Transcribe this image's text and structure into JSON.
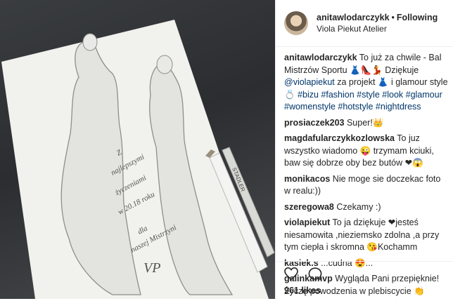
{
  "post": {
    "username": "anitawlodarczykk",
    "separator": "•",
    "follow_label": "Following",
    "location": "Viola Piekut Atelier",
    "likes": "961 likes"
  },
  "caption": {
    "user": "anitawlodarczykk",
    "text1": "To już za chwile - Bal Mistrzów Sportu 👗👠💃 Dziękuje ",
    "mention": "@violapiekut",
    "text2": " za projekt 👗 i glamour style💍 ",
    "hashtags": "#bizu #fashion #style #look #glamour #womenstyle #hotstyle #nightdress"
  },
  "comments": [
    {
      "user": "prosiaczek203",
      "text": "Super!👑"
    },
    {
      "user": "magdafularczykkozlowska",
      "text": "To juz wszystko wiadomo 😜 trzymam kciuki, baw się dobrze oby bez butów ❤😱"
    },
    {
      "user": "monikacos",
      "text": "Nie moge sie doczekac foto w realu:))"
    },
    {
      "user": "szeregowa8",
      "text": "Czekamy :)"
    },
    {
      "user": "violapiekut",
      "text": "To ja dziękuje ❤jesteś niesamowita ,nieziemsko zdolna ,a przy tym ciepła i skromna 😘Kochamm"
    },
    {
      "user": "kasiek.s",
      "text": "...cudna 😍..."
    },
    {
      "user": "galinkamvp",
      "text": "Wygląda Pani przepięknie! Życzę powodzenia w plebiscycie 👏"
    }
  ],
  "sketch_text": [
    "Z",
    "najlepszymi",
    "życzeniami",
    "w 20.18 roku",
    "dla",
    "naszej Mistrzyni"
  ],
  "sketch_sign": "VP",
  "pencil_brand": "STADLER",
  "icons": {
    "like": "heart-icon",
    "comment": "comment-icon"
  },
  "colors": {
    "hashtag": "#003569",
    "border": "#efefef"
  }
}
